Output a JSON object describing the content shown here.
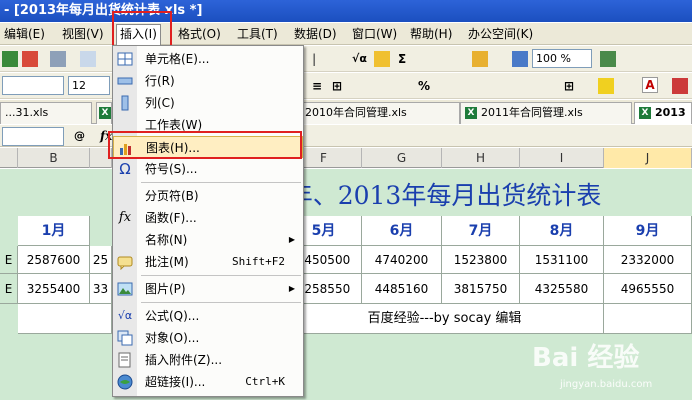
{
  "window": {
    "title": "- [2013年每月出货统计表 xls *]"
  },
  "menubar": {
    "items": [
      {
        "key": "edit",
        "label": "编辑(E)"
      },
      {
        "key": "view",
        "label": "视图(V)"
      },
      {
        "key": "insert",
        "label": "插入(I)"
      },
      {
        "key": "format",
        "label": "格式(O)"
      },
      {
        "key": "tools",
        "label": "工具(T)"
      },
      {
        "key": "data",
        "label": "数据(D)"
      },
      {
        "key": "window",
        "label": "窗口(W)"
      },
      {
        "key": "help",
        "label": "帮助(H)"
      },
      {
        "key": "office",
        "label": "办公空间(K)"
      }
    ]
  },
  "toolbar": {
    "zoom": "100 %",
    "font_size": "12"
  },
  "tabs": [
    {
      "label": "...31.xls"
    },
    {
      "label": "2010年合同管理.xls"
    },
    {
      "label": "2011年合同管理.xls"
    },
    {
      "label": "2013"
    }
  ],
  "sheet": {
    "columns": [
      "B",
      "F",
      "G",
      "H",
      "I",
      "J"
    ],
    "title": "012年、2013年每月出货统计表",
    "months": [
      "1月",
      "5月",
      "6月",
      "7月",
      "8月",
      "9月"
    ],
    "row_labels": [
      "E",
      "E"
    ],
    "rows": [
      {
        "b": "2587600",
        "b2": "25",
        "f": "1450500",
        "g": "4740200",
        "h": "1523800",
        "i": "1531100",
        "j": "2332000"
      },
      {
        "b": "3255400",
        "b2": "33",
        "f": "5258550",
        "g": "4485160",
        "h": "3815750",
        "i": "4325580",
        "j": "4965550"
      }
    ],
    "footer_note": "百度经验---by socay 编辑"
  },
  "insert_menu": {
    "items": [
      {
        "label": "单元格(E)...",
        "icon": "cells-icon"
      },
      {
        "label": "行(R)",
        "icon": "row-icon"
      },
      {
        "label": "列(C)",
        "icon": "column-icon"
      },
      {
        "label": "工作表(W)",
        "icon": "worksheet-icon"
      },
      {
        "label": "图表(H)...",
        "icon": "chart-icon"
      },
      {
        "label": "符号(S)...",
        "icon": "omega-icon"
      },
      {
        "label": "分页符(B)",
        "icon": ""
      },
      {
        "label": "函数(F)...",
        "icon": "fx-icon"
      },
      {
        "label": "名称(N)",
        "icon": ""
      },
      {
        "label": "批注(M)",
        "icon": "comment-icon",
        "shortcut": "Shift+F2"
      },
      {
        "label": "图片(P)",
        "icon": "picture-icon"
      },
      {
        "label": "公式(Q)...",
        "icon": "formula-icon"
      },
      {
        "label": "对象(O)...",
        "icon": "object-icon"
      },
      {
        "label": "插入附件(Z)...",
        "icon": "attachment-icon"
      },
      {
        "label": "超链接(I)...",
        "icon": "hyperlink-icon",
        "shortcut": "Ctrl+K"
      }
    ]
  },
  "watermark": {
    "brand": "Bai 经验",
    "url": "jingyan.baidu.com"
  }
}
